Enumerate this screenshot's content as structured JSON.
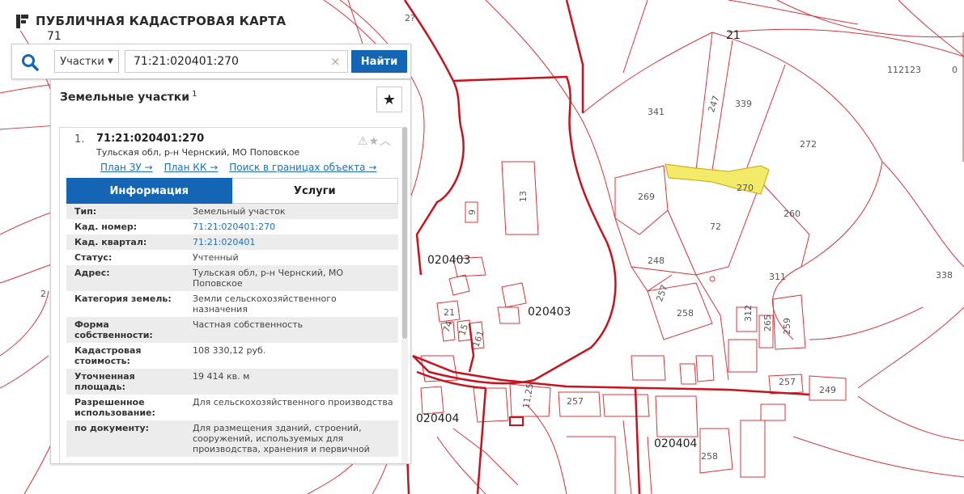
{
  "app": {
    "title": "ПУБЛИЧНАЯ КАДАСТРОВАЯ КАРТА",
    "logo_icon": "pkk-logo-icon"
  },
  "search": {
    "type_label": "Участки",
    "query": "71:21:020401:270",
    "clear_label": "×",
    "find_label": "Найти"
  },
  "results": {
    "header": "Земельные участки",
    "count": "1",
    "favorite_icon": "★",
    "card": {
      "index": "1.",
      "cad_number": "71:21:020401:270",
      "address": "Тульская обл, р-н Чернский, МО Поповское",
      "action_icons": "⚠★︿",
      "links": {
        "plan_zu": "План ЗУ →",
        "plan_kk": "План КК →",
        "search_bounds": "Поиск в границах объекта →"
      },
      "tabs": {
        "info": "Информация",
        "services": "Услуги"
      },
      "rows": [
        {
          "key": "Тип:",
          "value": "Земельный участок"
        },
        {
          "key": "Кад. номер:",
          "value": "71:21:020401:270"
        },
        {
          "key": "Кад. квартал:",
          "value": "71:21:020401"
        },
        {
          "key": "Статус:",
          "value": "Учтенный"
        },
        {
          "key": "Адрес:",
          "value": "Тульская обл, р-н Чернский, МО Поповское"
        },
        {
          "key": "Категория земель:",
          "value": "Земли сельскохозяйственного назначения"
        },
        {
          "key": "Форма собственности:",
          "value": "Частная собственность"
        },
        {
          "key": "Кадастровая стоимость:",
          "value": "108 330,12 руб."
        },
        {
          "key": "Уточненная площадь:",
          "value": "19 414 кв. м"
        },
        {
          "key": "Разрешенное использование:",
          "value": "Для сельскохозяйственного производства"
        },
        {
          "key": "по документу:",
          "value": "Для размещения зданий, строений, сооружений, используемых для производства, хранения и первичной"
        }
      ]
    }
  },
  "map": {
    "colors": {
      "parcel_line": "#d9343b",
      "quarter_line": "#c8121e",
      "selected_fill": "#f3ea6a"
    },
    "labels": {
      "q21": "21",
      "q71": "71",
      "p112123": "112123",
      "p0": "0",
      "p341": "341",
      "p247": "247",
      "p339": "339",
      "p272": "272",
      "p269": "269",
      "p270": "270",
      "p260": "260",
      "p72": "72",
      "p248": "248",
      "p311": "311",
      "p338": "338",
      "p257a": "257",
      "p258a": "258",
      "p312": "312",
      "p265": "265",
      "p259": "259",
      "p257b": "257",
      "p249": "249",
      "p257c": "257",
      "p1125": "11,25",
      "p258b": "258",
      "p13": "13",
      "p9": "9",
      "p21": "21",
      "p74": "74",
      "p15": "15",
      "p161": "161",
      "p2": "2",
      "p29": "2?",
      "q020403a": "020403",
      "q020403b": "020403",
      "q020404a": "020404",
      "q020404b": "020404"
    }
  }
}
